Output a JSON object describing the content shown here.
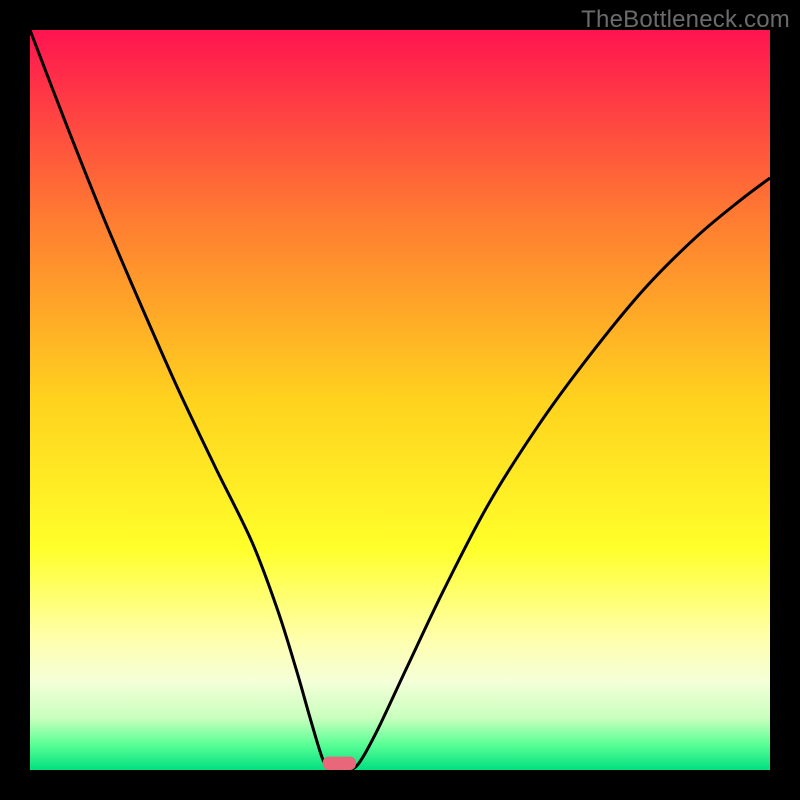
{
  "watermark": "TheBottleneck.com",
  "chart_data": {
    "type": "line",
    "title": "",
    "xlabel": "",
    "ylabel": "",
    "xlim": [
      0,
      1
    ],
    "ylim": [
      0,
      1
    ],
    "note": "Axes are unlabeled; values are normalized 0–1 read from pixel positions.",
    "gradient_stops": [
      {
        "offset": 0.0,
        "color": "#ff1450"
      },
      {
        "offset": 0.25,
        "color": "#ff7a32"
      },
      {
        "offset": 0.5,
        "color": "#ffd21e"
      },
      {
        "offset": 0.7,
        "color": "#ffff2a"
      },
      {
        "offset": 0.82,
        "color": "#ffffaa"
      },
      {
        "offset": 0.88,
        "color": "#f5ffd8"
      },
      {
        "offset": 0.93,
        "color": "#c8ffbe"
      },
      {
        "offset": 0.965,
        "color": "#5cff96"
      },
      {
        "offset": 1.0,
        "color": "#00e080"
      }
    ],
    "curve_points": [
      {
        "x": 0.0,
        "y": 1.0
      },
      {
        "x": 0.05,
        "y": 0.87
      },
      {
        "x": 0.1,
        "y": 0.745
      },
      {
        "x": 0.15,
        "y": 0.628
      },
      {
        "x": 0.2,
        "y": 0.515
      },
      {
        "x": 0.25,
        "y": 0.41
      },
      {
        "x": 0.3,
        "y": 0.308
      },
      {
        "x": 0.335,
        "y": 0.215
      },
      {
        "x": 0.36,
        "y": 0.135
      },
      {
        "x": 0.378,
        "y": 0.072
      },
      {
        "x": 0.392,
        "y": 0.025
      },
      {
        "x": 0.4,
        "y": 0.005
      },
      {
        "x": 0.41,
        "y": 0.0
      },
      {
        "x": 0.43,
        "y": 0.0
      },
      {
        "x": 0.445,
        "y": 0.01
      },
      {
        "x": 0.47,
        "y": 0.055
      },
      {
        "x": 0.51,
        "y": 0.14
      },
      {
        "x": 0.56,
        "y": 0.245
      },
      {
        "x": 0.62,
        "y": 0.36
      },
      {
        "x": 0.69,
        "y": 0.47
      },
      {
        "x": 0.76,
        "y": 0.565
      },
      {
        "x": 0.83,
        "y": 0.65
      },
      {
        "x": 0.9,
        "y": 0.72
      },
      {
        "x": 0.96,
        "y": 0.77
      },
      {
        "x": 1.0,
        "y": 0.8
      }
    ],
    "marker": {
      "x": 0.418,
      "width": 0.045,
      "height": 0.018,
      "color": "#e8677a",
      "rx": 6
    }
  }
}
